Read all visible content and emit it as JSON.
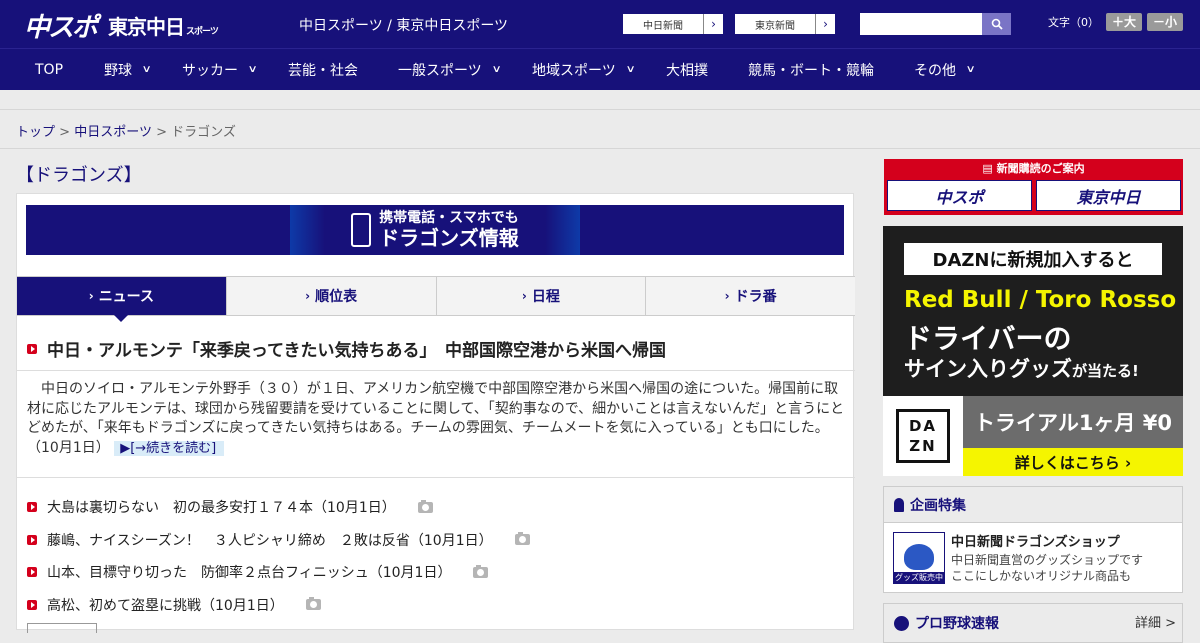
{
  "header": {
    "logo_primary": "中スポ",
    "logo_secondary": "東京中日",
    "logo_secondary_small": "スポーツ",
    "site_names": "中日スポーツ / 東京中日スポーツ",
    "paper_buttons": [
      {
        "label": "中日新聞",
        "arrow": "›"
      },
      {
        "label": "東京新聞",
        "arrow": "›"
      }
    ],
    "search_placeholder": "",
    "font_label": "文字（0）",
    "font_larger": "＋大",
    "font_smaller": "－小"
  },
  "nav": {
    "items": [
      {
        "label": "TOP",
        "has_menu": false
      },
      {
        "label": "野球",
        "has_menu": true
      },
      {
        "label": "サッカー",
        "has_menu": true
      },
      {
        "label": "芸能・社会",
        "has_menu": false
      },
      {
        "label": "一般スポーツ",
        "has_menu": true
      },
      {
        "label": "地域スポーツ",
        "has_menu": true
      },
      {
        "label": "大相撲",
        "has_menu": false
      },
      {
        "label": "競馬・ボート・競輪",
        "has_menu": false
      },
      {
        "label": "その他",
        "has_menu": true
      }
    ]
  },
  "breadcrumb": {
    "items": [
      "トップ",
      "中日スポーツ",
      "ドラゴンズ"
    ],
    "sep": ">"
  },
  "page": {
    "title": "【ドラゴンズ】",
    "promo_line1": "携帯電話・スマホでも",
    "promo_line2": "ドラゴンズ情報",
    "tabs": [
      {
        "label": "ニュース",
        "active": true
      },
      {
        "label": "順位表",
        "active": false
      },
      {
        "label": "日程",
        "active": false
      },
      {
        "label": "ドラ番",
        "active": false
      }
    ],
    "headline": "中日・アルモンテ「来季戻ってきたい気持ちある」　中部国際空港から米国へ帰国",
    "body": "中日のソイロ・アルモンテ外野手（３０）が１日、アメリカン航空機で中部国際空港から米国へ帰国の途についた。帰国前に取材に応じたアルモンテは、球団から残留要請を受けていることに関して、「契約事なので、細かいことは言えないんだ」と言うにとどめたが、「来年もドラゴンズに戻ってきたい気持ちはある。チームの雰囲気、チームメートを気に入っている」とも口にした。（10月1日）",
    "read_more": "[→続きを読む]",
    "articles": [
      {
        "title": "大島は裏切らない　初の最多安打１７４本（10月1日）",
        "photo": true
      },
      {
        "title": "藤嶋、ナイスシーズン！　３人ピシャリ締め　２敗は反省（10月1日）",
        "photo": true
      },
      {
        "title": "山本、目標守り切った　防御率２点台フィニッシュ（10月1日）",
        "photo": true
      },
      {
        "title": "高松、初めて盗塁に挑戦（10月1日）",
        "photo": true
      }
    ]
  },
  "sidebar": {
    "subscription_header": "新聞購読のご案内",
    "subscription_buttons": [
      "中スポ",
      "東京中日"
    ],
    "dazn": {
      "banner": "DAZNに新規加入すると",
      "line1": "Red Bull / Toro Rosso",
      "line2": "ドライバーの",
      "line3": "サイン入りグッズ",
      "line3_suffix": "が当たる!",
      "logo_text": "DA ZN",
      "trial": "トライアル1ヶ月 ¥0",
      "cta": "詳しくはこちら ›"
    },
    "special": {
      "header": "企画特集",
      "image_tag": "グッズ販売中",
      "title": "中日新聞ドラゴンズショップ",
      "desc1": "中日新聞直営のグッズショップです",
      "desc2": "ここにしかないオリジナル商品も"
    },
    "pro_baseball": {
      "header": "プロ野球速報",
      "detail": "詳細 >"
    }
  },
  "colors": {
    "brand_navy": "#17117a",
    "accent_red": "#d4001c",
    "dazn_yellow": "#f5f500"
  }
}
